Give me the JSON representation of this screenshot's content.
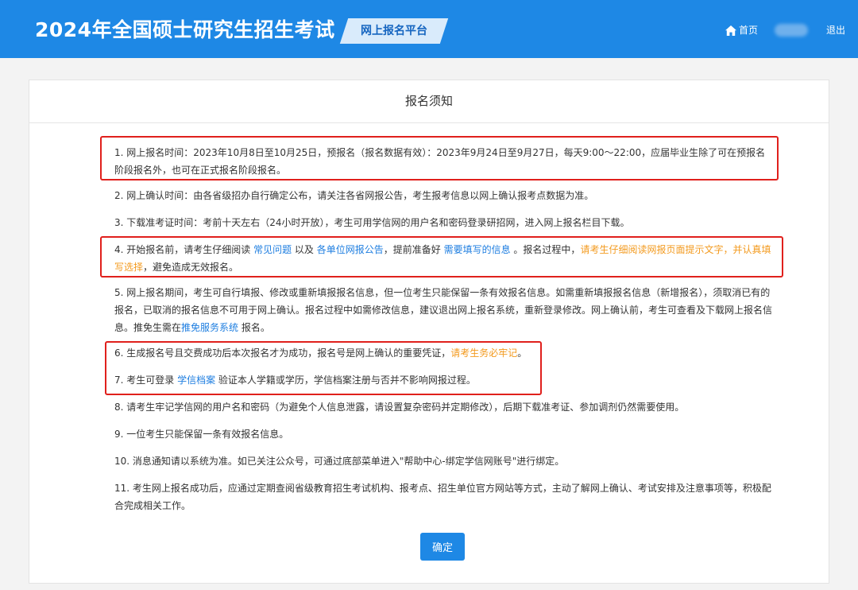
{
  "header": {
    "title": "2024年全国硕士研究生招生考试",
    "platform": "网上报名平台",
    "home": "首页",
    "logout": "退出"
  },
  "card": {
    "title": "报名须知",
    "confirm": "确定"
  },
  "notices": {
    "n1": "1. 网上报名时间：2023年10月8日至10月25日，预报名（报名数据有效）：2023年9月24日至9月27日，每天9:00～22:00，应届毕业生除了可在预报名阶段报名外，也可在正式报名阶段报名。",
    "n2": "2. 网上确认时间：由各省级招办自行确定公布，请关注各省网报公告，考生报考信息以网上确认报考点数据为准。",
    "n3": "3. 下载准考证时间：考前十天左右（24小时开放），考生可用学信网的用户名和密码登录研招网，进入网上报名栏目下载。",
    "n4": {
      "p1": "4. 开始报名前，请考生仔细阅读 ",
      "l1": "常见问题",
      "p2": " 以及 ",
      "l2": "各单位网报公告",
      "p3": "，提前准备好 ",
      "l3": "需要填写的信息",
      "p4": " 。报名过程中，",
      "w1": "请考生仔细阅读网报页面提示文字，并认真填写选择",
      "p5": "，避免造成无效报名。"
    },
    "n5": {
      "p1": "5. 网上报名期间，考生可自行填报、修改或重新填报报名信息，但一位考生只能保留一条有效报名信息。如需重新填报报名信息（新增报名），须取消已有的报名，已取消的报名信息不可用于网上确认。报名过程中如需修改信息，建议退出网上报名系统，重新登录修改。网上确认前，考生可查看及下载网上报名信息。推免生需在",
      "l1": "推免服务系统",
      "p2": " 报名。"
    },
    "n6": {
      "p1": "6. 生成报名号且交费成功后本次报名才为成功，报名号是网上确认的重要凭证，",
      "w1": "请考生务必牢记",
      "p2": "。"
    },
    "n7": {
      "p1": "7. 考生可登录 ",
      "l1": "学信档案",
      "p2": " 验证本人学籍或学历，学信档案注册与否并不影响网报过程。"
    },
    "n8": "8. 请考生牢记学信网的用户名和密码（为避免个人信息泄露，请设置复杂密码并定期修改），后期下载准考证、参加调剂仍然需要使用。",
    "n9": "9. 一位考生只能保留一条有效报名信息。",
    "n10": "10. 消息通知请以系统为准。如已关注公众号，可通过底部菜单进入\"帮助中心-绑定学信网账号\"进行绑定。",
    "n11": "11. 考生网上报名成功后，应通过定期查阅省级教育招生考试机构、报考点、招生单位官方网站等方式，主动了解网上确认、考试安排及注意事项等，积极配合完成相关工作。"
  },
  "colors": {
    "header": "#1e88e5",
    "link": "#1e7ee0",
    "warning": "#f39a1e",
    "highlight_box": "#e0201c"
  }
}
